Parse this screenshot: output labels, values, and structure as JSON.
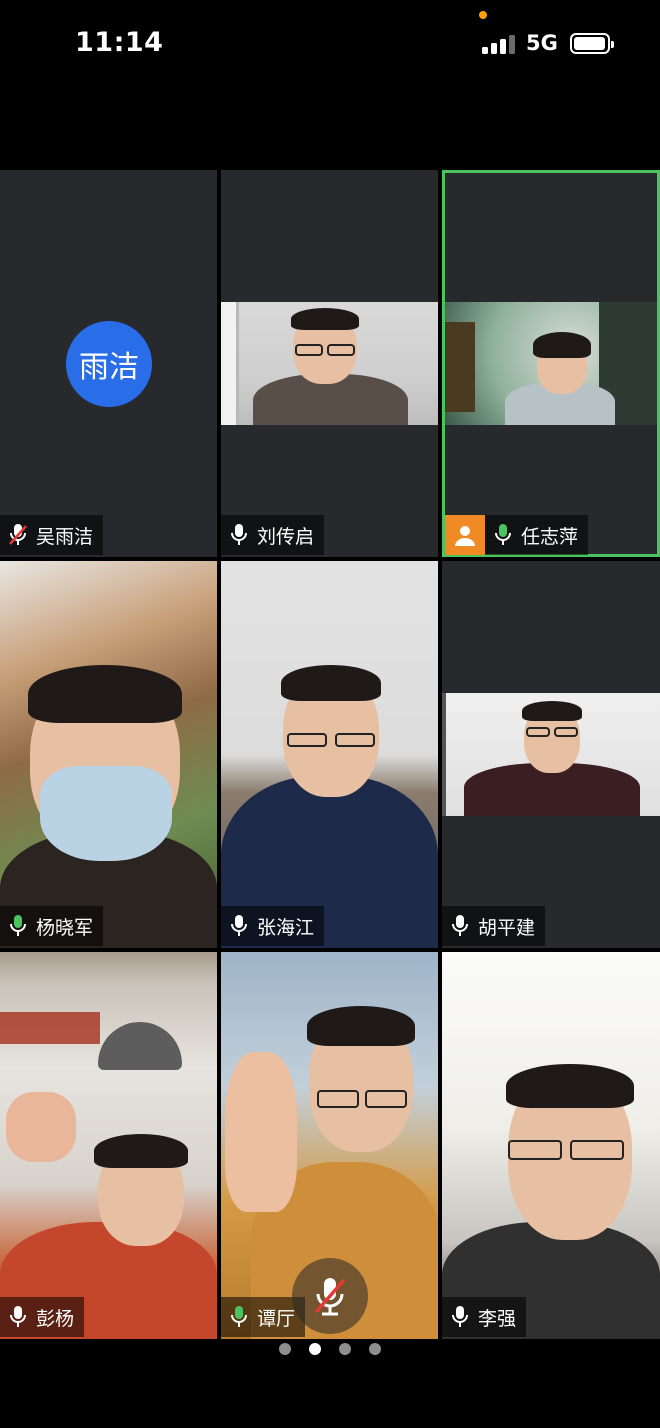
{
  "status_bar": {
    "time": "11:14",
    "network": "5G",
    "signal_bars": 3,
    "battery_fraction": 0.85
  },
  "participants": [
    {
      "name": "吴雨洁",
      "mic": "muted",
      "video": false,
      "avatar_text": "雨洁",
      "avatar_color": "#2a6de8"
    },
    {
      "name": "刘传启",
      "mic": "on",
      "video": true
    },
    {
      "name": "任志萍",
      "mic": "speaking",
      "video": true,
      "host": true,
      "active_speaker": true
    },
    {
      "name": "杨晓军",
      "mic": "speaking",
      "video": true
    },
    {
      "name": "张海江",
      "mic": "on",
      "video": true
    },
    {
      "name": "胡平建",
      "mic": "on",
      "video": true
    },
    {
      "name": "彭杨",
      "mic": "on",
      "video": true
    },
    {
      "name": "谭厅",
      "mic": "speaking",
      "video": true
    },
    {
      "name": "李强",
      "mic": "on",
      "video": true
    }
  ],
  "pager": {
    "pages": 4,
    "current_page": 2
  },
  "colors": {
    "active_border": "#4bc35e",
    "mic_speaking": "#4bc35e",
    "mic_muted": "#e53935",
    "host_badge": "#f08a24",
    "tile_background": "#27292c"
  },
  "icons": {
    "mute_toggle": "microphone-muted-icon",
    "host_badge": "person-icon"
  }
}
